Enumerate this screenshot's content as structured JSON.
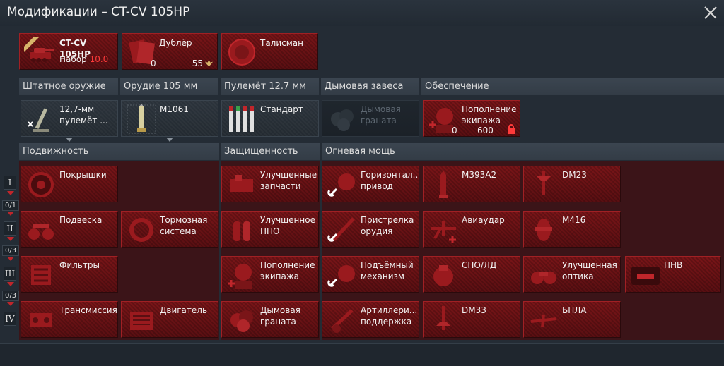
{
  "window": {
    "title": "Модификации – CT-CV 105HP"
  },
  "top": {
    "vehicle": {
      "name": "CT-CV 105HP",
      "set_label": "Набор",
      "set_value": "10.0"
    },
    "backup": {
      "label": "Дублёр",
      "count": "0",
      "price": "55"
    },
    "talisman": {
      "label": "Талисман"
    }
  },
  "weapon_tabs": [
    {
      "label": "Штатное оружие",
      "item": "12,7-мм пулемёт ..."
    },
    {
      "label": "Орудие 105 мм",
      "item": "M1061"
    },
    {
      "label": "Пулемёт 12.7 мм",
      "item": "Стандарт"
    },
    {
      "label": "Дымовая завеса",
      "item": "Дымовая граната"
    },
    {
      "label": "Обеспечение",
      "item": "Пополнение экипажа",
      "count": "0",
      "price": "600"
    }
  ],
  "sections": {
    "mobility": "Подвижность",
    "protection": "Защищенность",
    "firepower": "Огневая мощь"
  },
  "tiers": [
    {
      "label": "I",
      "count": "0/1"
    },
    {
      "label": "II",
      "count": "0/3"
    },
    {
      "label": "III",
      "count": "0/3"
    },
    {
      "label": "IV",
      "count": ""
    }
  ],
  "mods": {
    "tyres": "Покрышки",
    "suspension": "Подвеска",
    "brakes": "Тормозная система",
    "filters": "Фильтры",
    "transmission": "Трансмиссия",
    "engine": "Двигатель",
    "parts": "Улучшенные запчасти",
    "fpe": "Улучшенное ППО",
    "crew": "Пополнение экипажа",
    "smoke": "Дымовая граната",
    "horizontal": "Горизонтал... привод",
    "m393": "M393A2",
    "dm23": "DM23",
    "adjust": "Пристрелка орудия",
    "airstrike": "Авиаудар",
    "m416": "M416",
    "elevation": "Подъёмный механизм",
    "spold": "СПО/ЛД",
    "optics": "Улучшенная оптика",
    "nv": "ПНВ",
    "artillery": "Артиллери... поддержка",
    "dm33": "DM33",
    "uav": "БПЛА"
  },
  "colors": {
    "accent": "#c0262b",
    "card": "#6b1215",
    "panel": "#242c35"
  }
}
